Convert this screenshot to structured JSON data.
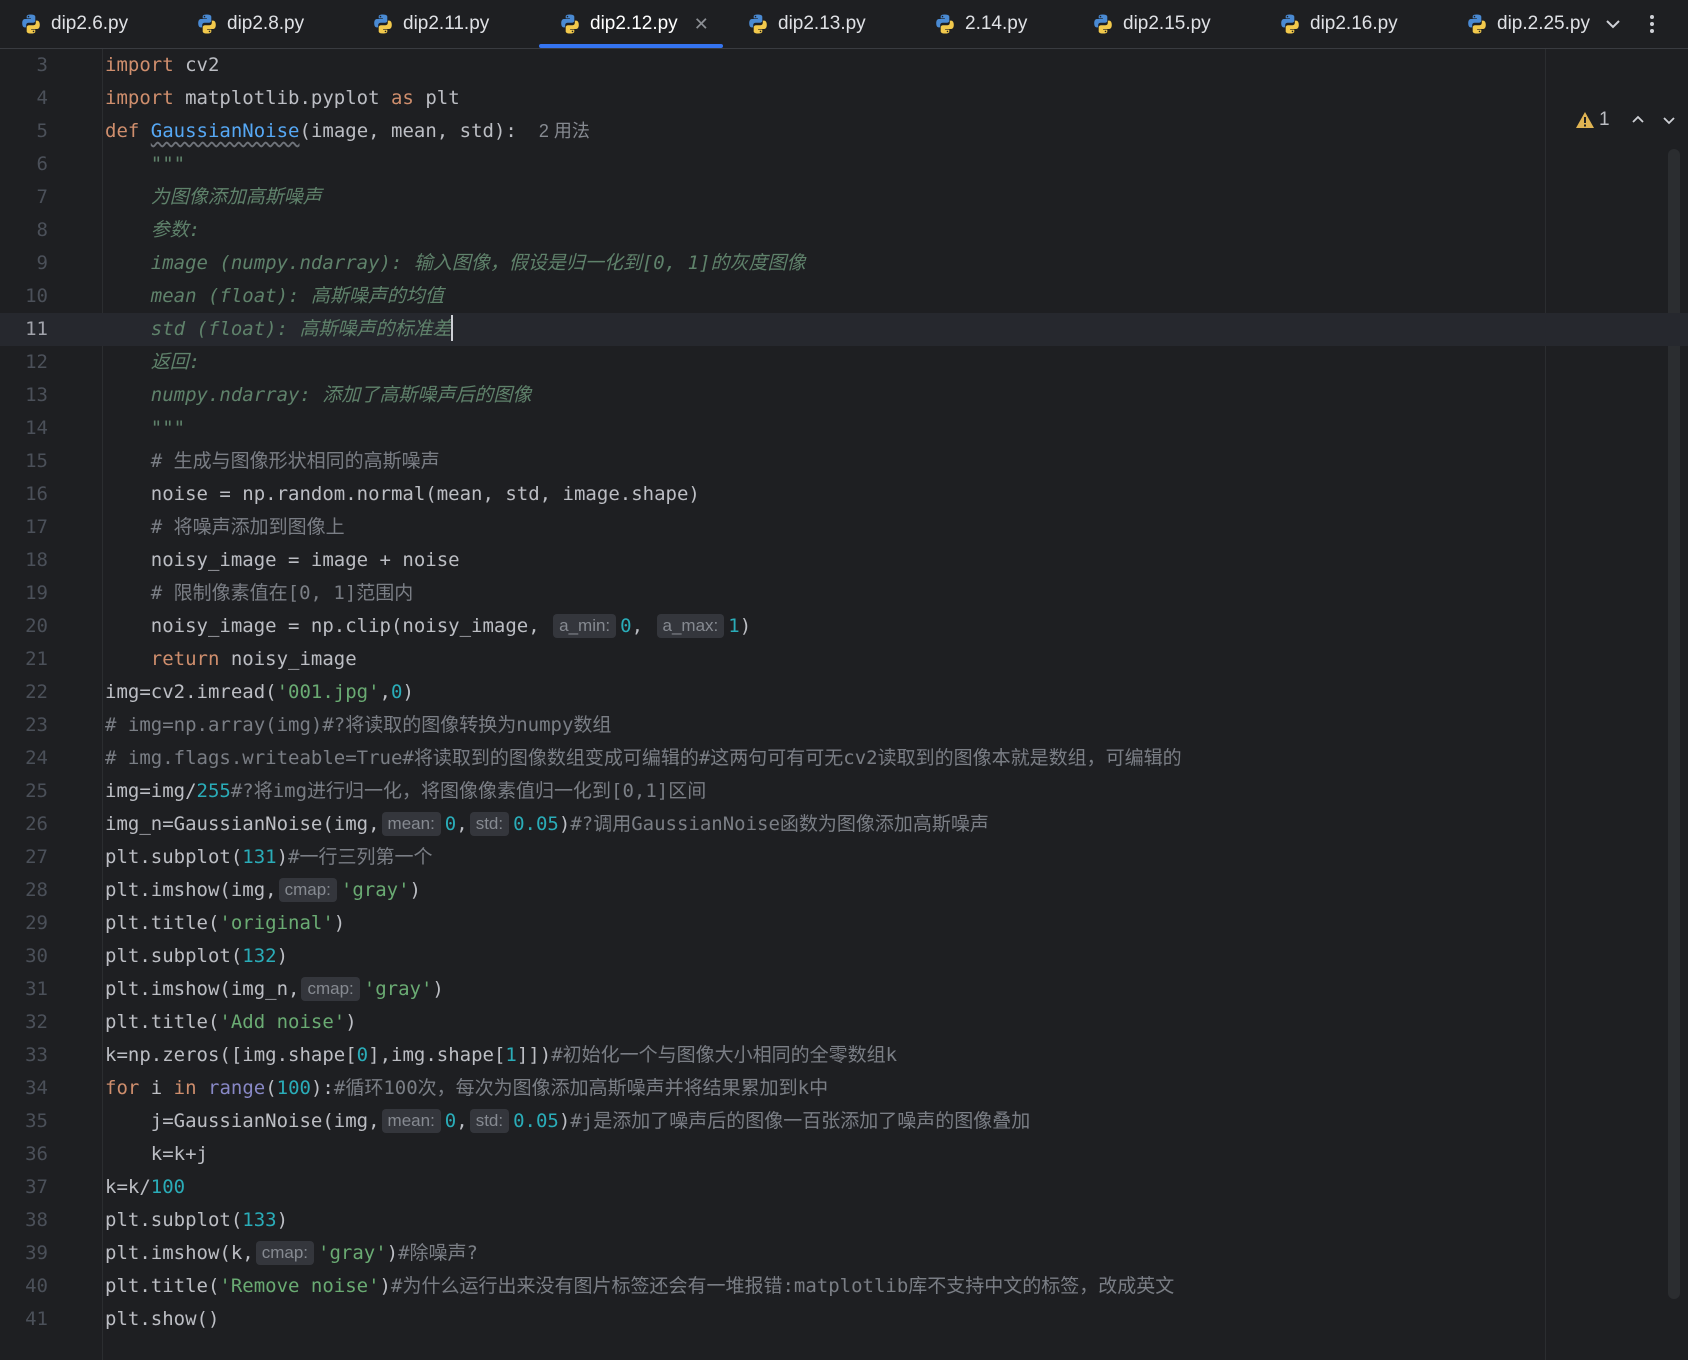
{
  "tabs": [
    {
      "label": "dip2.6.py"
    },
    {
      "label": "dip2.8.py"
    },
    {
      "label": "dip2.11.py"
    },
    {
      "label": "dip2.12.py",
      "active": true
    },
    {
      "label": "dip2.13.py"
    },
    {
      "label": "2.14.py"
    },
    {
      "label": "dip2.15.py"
    },
    {
      "label": "dip2.16.py"
    },
    {
      "label": "dip.2.25.py"
    }
  ],
  "warnings": {
    "count": "1"
  },
  "current_line": "11",
  "lines": {
    "l3": {
      "n": "3",
      "t1": "import",
      "t2": " cv2"
    },
    "l4": {
      "n": "4",
      "t1": "import",
      "t2": " matplotlib.pyplot ",
      "t3": "as",
      "t4": " plt"
    },
    "l5": {
      "n": "5",
      "t1": "def",
      "t2": " ",
      "t3": "GaussianNoise",
      "t4": "(image, mean, std):",
      "hint": "2 用法"
    },
    "l6": {
      "n": "6",
      "t1": "    \"\"\""
    },
    "l7": {
      "n": "7",
      "t1": "    为图像添加高斯噪声"
    },
    "l8": {
      "n": "8",
      "t1": "    参数:"
    },
    "l9": {
      "n": "9",
      "t1": "    image (numpy.ndarray): 输入图像，假设是归一化到[0, 1]的灰度图像"
    },
    "l10": {
      "n": "10",
      "t1": "    mean (float): 高斯噪声的均值"
    },
    "l11": {
      "n": "11",
      "t1": "    std (float): 高斯噪声的标准差"
    },
    "l12": {
      "n": "12",
      "t1": "    返回:"
    },
    "l13": {
      "n": "13",
      "t1": "    numpy.ndarray: 添加了高斯噪声后的图像"
    },
    "l14": {
      "n": "14",
      "t1": "    \"\"\""
    },
    "l15": {
      "n": "15",
      "t1": "    # 生成与图像形状相同的高斯噪声"
    },
    "l16": {
      "n": "16",
      "t1": "    noise = np.random.normal(mean, std, image.shape)"
    },
    "l17": {
      "n": "17",
      "t1": "    # 将噪声添加到图像上"
    },
    "l18": {
      "n": "18",
      "t1": "    noisy_image = image + noise"
    },
    "l19": {
      "n": "19",
      "t1": "    # 限制像素值在[0, 1]范围内"
    },
    "l20": {
      "n": "20",
      "t1": "    noisy_image = np.clip(noisy_image, ",
      "h1": "a_min:",
      "t2": "0",
      "t3": ", ",
      "h2": "a_max:",
      "t4": "1",
      "t5": ")"
    },
    "l21": {
      "n": "21",
      "t1": "    return",
      "t2": " noisy_image"
    },
    "l22": {
      "n": "22",
      "t1": "img=cv2.imread(",
      "t2": "'001.jpg'",
      "t3": ",",
      "t4": "0",
      "t5": ")"
    },
    "l23": {
      "n": "23",
      "t1": "# img=np.array(img)#?将读取的图像转换为numpy数组"
    },
    "l24": {
      "n": "24",
      "t1": "# img.flags.writeable=True#将读取到的图像数组变成可编辑的#这两句可有可无cv2读取到的图像本就是数组，可编辑的"
    },
    "l25": {
      "n": "25",
      "t1": "img=img/",
      "t2": "255",
      "t3": "#?将img进行归一化，将图像像素值归一化到[0,1]区间"
    },
    "l26": {
      "n": "26",
      "t1": "img_n=GaussianNoise(img,",
      "h1": "mean:",
      "t2": "0",
      "t3": ",",
      "h2": "std:",
      "t4": "0.05",
      "t5": ")",
      "t6": "#?调用GaussianNoise函数为图像添加高斯噪声"
    },
    "l27": {
      "n": "27",
      "t1": "plt.subplot(",
      "t2": "131",
      "t3": ")",
      "t4": "#一行三列第一个"
    },
    "l28": {
      "n": "28",
      "t1": "plt.imshow(img,",
      "h1": "cmap:",
      "t2": "'gray'",
      "t3": ")"
    },
    "l29": {
      "n": "29",
      "t1": "plt.title(",
      "t2": "'original'",
      "t3": ")"
    },
    "l30": {
      "n": "30",
      "t1": "plt.subplot(",
      "t2": "132",
      "t3": ")"
    },
    "l31": {
      "n": "31",
      "t1": "plt.imshow(img_n,",
      "h1": "cmap:",
      "t2": "'gray'",
      "t3": ")"
    },
    "l32": {
      "n": "32",
      "t1": "plt.title(",
      "t2": "'Add noise'",
      "t3": ")"
    },
    "l33": {
      "n": "33",
      "t1": "k=np.zeros([img.shape[",
      "t2": "0",
      "t3": "],img.shape[",
      "t4": "1",
      "t5": "]])",
      "t6": "#初始化一个与图像大小相同的全零数组k"
    },
    "l34": {
      "n": "34",
      "t1": "for",
      "t2": " i ",
      "t3": "in",
      "t4": " ",
      "t5": "range",
      "t6": "(",
      "t7": "100",
      "t8": "):",
      "t9": "#循环100次，每次为图像添加高斯噪声并将结果累加到k中"
    },
    "l35": {
      "n": "35",
      "t1": "    j=GaussianNoise(img,",
      "h1": "mean:",
      "t2": "0",
      "t3": ",",
      "h2": "std:",
      "t4": "0.05",
      "t5": ")",
      "t6": "#j是添加了噪声后的图像一百张添加了噪声的图像叠加"
    },
    "l36": {
      "n": "36",
      "t1": "    k=k+j"
    },
    "l37": {
      "n": "37",
      "t1": "k=k/",
      "t2": "100"
    },
    "l38": {
      "n": "38",
      "t1": "plt.subplot(",
      "t2": "133",
      "t3": ")"
    },
    "l39": {
      "n": "39",
      "t1": "plt.imshow(k,",
      "h1": "cmap:",
      "t2": "'gray'",
      "t3": ")",
      "t4": "#除噪声?"
    },
    "l40": {
      "n": "40",
      "t1": "plt.title(",
      "t2": "'Remove noise'",
      "t3": ")",
      "t4": "#为什么运行出来没有图片标签还会有一堆报错:matplotlib库不支持中文的标签，改成英文"
    },
    "l41": {
      "n": "41",
      "t1": "plt.show()"
    }
  },
  "colors": {
    "background": "#1e1f22",
    "keyword": "#cf8e6d",
    "function": "#56a8f5",
    "string": "#6aab73",
    "number": "#2aacb8",
    "docstring": "#5f826b",
    "comment": "#7a7e85",
    "accent": "#3574f0"
  }
}
